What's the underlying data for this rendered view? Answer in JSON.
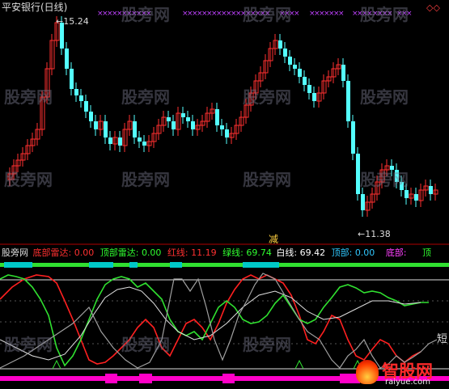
{
  "title": "平安银行(日线)",
  "watermark": "股旁网",
  "price": {
    "high_label": "15.24",
    "low_label": "11.38",
    "event_label": "减"
  },
  "indicator": {
    "name": "股旁网",
    "fields": [
      {
        "label": "底部雷达:",
        "value": "0.00",
        "color": "#ff3030"
      },
      {
        "label": "顶部雷达:",
        "value": "0.00",
        "color": "#30ff30"
      },
      {
        "label": "红线:",
        "value": "11.19",
        "color": "#ff3030"
      },
      {
        "label": "绿线:",
        "value": "69.74",
        "color": "#30ff30"
      },
      {
        "label": "白线:",
        "value": "69.42",
        "color": "#ffffff"
      },
      {
        "label": "顶部:",
        "value": "0.00",
        "color": "#30c8ff"
      },
      {
        "label": "底部:",
        "value": "",
        "color": "#ff40ff"
      },
      {
        "label": "顶",
        "value": "",
        "color": "#30ff30"
      }
    ],
    "short_mark": "短"
  },
  "logo": {
    "text": "智股网",
    "url": "raiyue.com"
  },
  "colors": {
    "up": "#ff3030",
    "down": "#54ffff",
    "red_line": "#ff2020",
    "green_line": "#30e030",
    "white_line": "#e0e0e0",
    "gray_line": "#a0a0a0",
    "magenta": "#ff00c8",
    "x_marks": "#c040ff"
  }
}
